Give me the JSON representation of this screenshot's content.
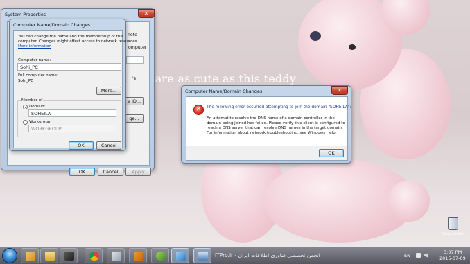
{
  "wallpaper": {
    "caption": "u are as cute as this teddy"
  },
  "desktop": {
    "recycle_bin_label": "Recycle Bin"
  },
  "system_properties": {
    "title": "System Properties",
    "background_tab_fragment": "note",
    "background_label_fragment": "omputer",
    "background_text_fragment_1": "'s",
    "background_button_fragment_1": "e ID...",
    "background_button_fragment_2": "ge...",
    "buttons": {
      "ok": "OK",
      "cancel": "Cancel",
      "apply": "Apply"
    }
  },
  "name_changes": {
    "title": "Computer Name/Domain Changes",
    "intro_line1": "You can change the name and the membership of this",
    "intro_line2": "computer. Changes might affect access to network resources.",
    "more_info_link": "More information",
    "computer_name_label": "Computer name:",
    "computer_name_value": "Sohi_PC",
    "full_name_label": "Full computer name:",
    "full_name_value": "Sohi_PC",
    "more_button": "More...",
    "member_of_label": "Member of",
    "domain_option": "Domain:",
    "domain_value": "SOHEILA",
    "workgroup_option": "Workgroup:",
    "workgroup_value": "WORKGROUP",
    "ok_button": "OK",
    "cancel_button": "Cancel"
  },
  "error_dialog": {
    "title": "Computer Name/Domain Changes",
    "headline": "The following error occurred attempting to join the domain \"SOHEILA\":",
    "body_line1": "An attempt to resolve the DNS name of a domain controller in the",
    "body_line2": "domain being joined has failed.  Please verify this client is configured to",
    "body_line3": "reach a DNS server that can resolve DNS names in the target domain.",
    "body_line4": "For information about network troubleshooting, see Windows Help.",
    "ok_button": "OK"
  },
  "taskbar": {
    "watermark": "انجمن تخصصی فناوری اطلاعات ایران - ITPro.ir",
    "language": "EN",
    "time": "3:07 PM",
    "date": "2015-07-09",
    "pinned_icons": [
      "media-player-icon",
      "folder-icon",
      "video-icon",
      "chrome-icon",
      "file-manager-icon",
      "torrent-icon",
      "frog-app-icon",
      "network-icon",
      "computer-icon"
    ]
  },
  "colors": {
    "accent": "#3c7fb1",
    "error_red": "#d8231f",
    "link": "#0645ad"
  }
}
